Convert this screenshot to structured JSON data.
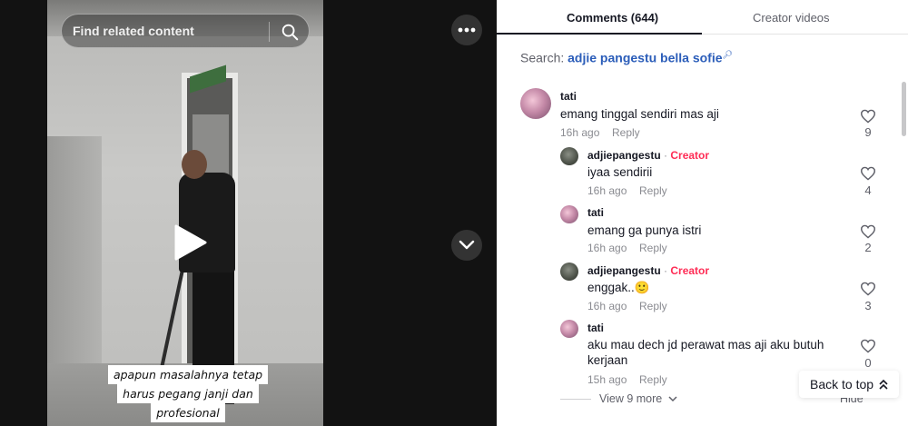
{
  "video": {
    "search_placeholder": "Find related content",
    "caption_lines": [
      "apapun masalahnya tetap",
      "harus pegang janji dan",
      "profesional"
    ]
  },
  "panel": {
    "tab_comments": "Comments (644)",
    "tab_creator_videos": "Creator videos",
    "search_prefix": "Search:",
    "search_query": "adjie pangestu bella sofie"
  },
  "comments": [
    {
      "username": "tati",
      "text": "emang tinggal sendiri mas aji",
      "time": "16h ago",
      "reply": "Reply",
      "likes": "9",
      "creator": false
    },
    {
      "username": "adjiepangestu",
      "creator_label": "Creator",
      "text": "iyaa sendirii",
      "time": "16h ago",
      "reply": "Reply",
      "likes": "4",
      "creator": true
    },
    {
      "username": "tati",
      "text": "emang ga punya istri",
      "time": "16h ago",
      "reply": "Reply",
      "likes": "2",
      "creator": false
    },
    {
      "username": "adjiepangestu",
      "creator_label": "Creator",
      "text": "enggak..🙂",
      "time": "16h ago",
      "reply": "Reply",
      "likes": "3",
      "creator": true
    },
    {
      "username": "tati",
      "text": "aku mau dech jd perawat mas aji aku butuh kerjaan",
      "time": "15h ago",
      "reply": "Reply",
      "likes": "0",
      "creator": false
    }
  ],
  "footer": {
    "view_more": "View 9 more",
    "hide": "Hide",
    "back_to_top": "Back to top"
  },
  "colors": {
    "accent_creator": "#fe2c55",
    "search_link": "#2b5db9"
  }
}
